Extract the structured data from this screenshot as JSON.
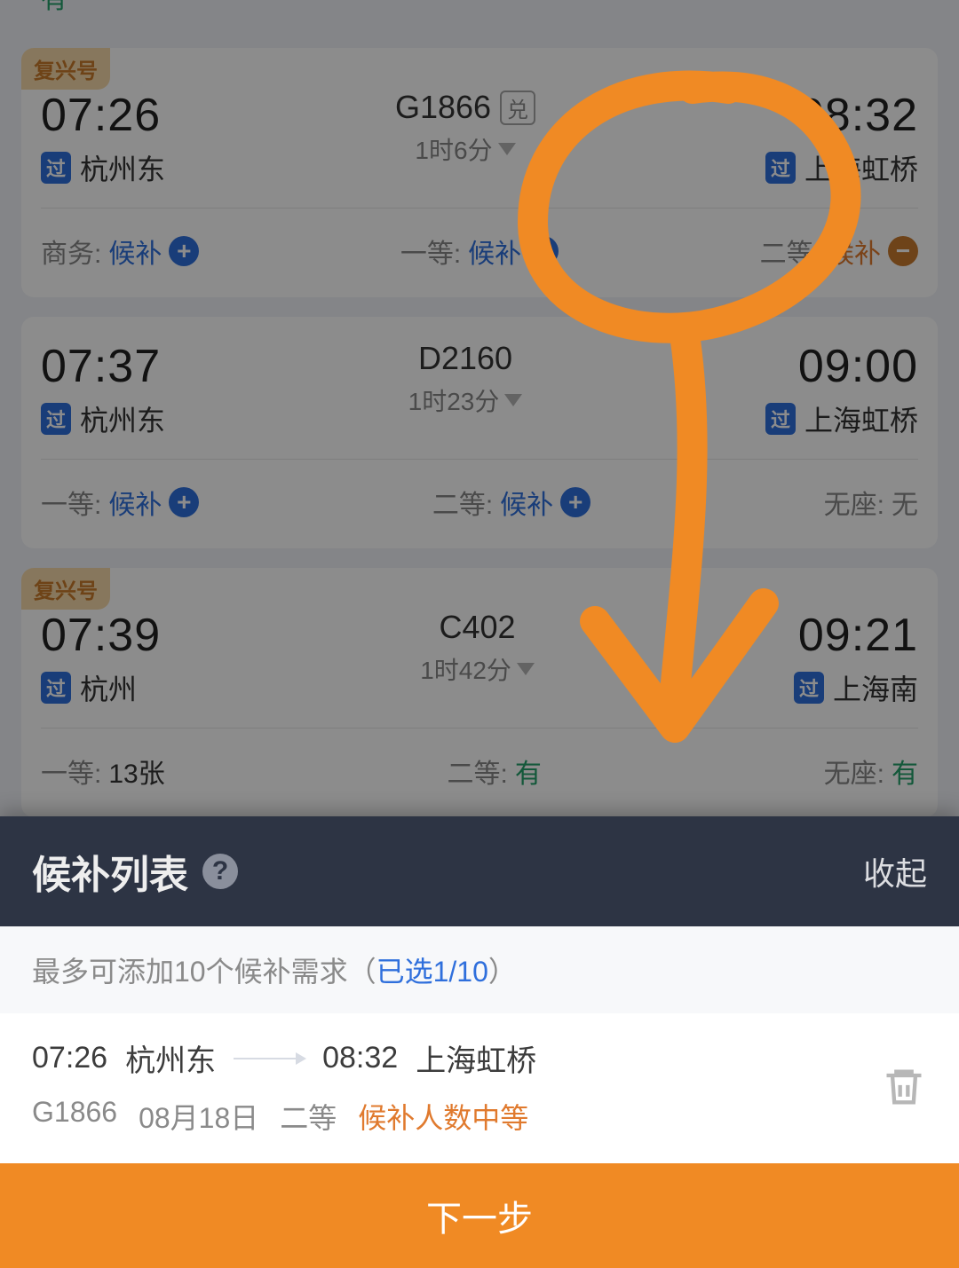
{
  "list_top_fragment": "有",
  "trains": [
    {
      "fuxing_badge": "复兴号",
      "depart_time": "07:26",
      "depart_station": "杭州东",
      "train_no": "G1866",
      "exchange_badge": "兑",
      "duration": "1时6分",
      "arrive_time": "08:32",
      "arrive_station": "上海虹桥",
      "seats": [
        {
          "label": "商务:",
          "value": "候补",
          "style": "blue",
          "icon": "plus"
        },
        {
          "label": "一等:",
          "value": "候补",
          "style": "blue",
          "icon": "plus"
        },
        {
          "label": "二等:",
          "value": "候补",
          "style": "orange",
          "icon": "minus"
        }
      ]
    },
    {
      "depart_time": "07:37",
      "depart_station": "杭州东",
      "train_no": "D2160",
      "duration": "1时23分",
      "arrive_time": "09:00",
      "arrive_station": "上海虹桥",
      "seats": [
        {
          "label": "一等:",
          "value": "候补",
          "style": "blue",
          "icon": "plus"
        },
        {
          "label": "二等:",
          "value": "候补",
          "style": "blue",
          "icon": "plus"
        },
        {
          "label": "无座:",
          "value": "无",
          "style": "gray"
        }
      ]
    },
    {
      "fuxing_badge": "复兴号",
      "depart_time": "07:39",
      "depart_station": "杭州",
      "train_no": "C402",
      "duration": "1时42分",
      "arrive_time": "09:21",
      "arrive_station": "上海南",
      "seats": [
        {
          "label": "一等:",
          "value": "13张",
          "style": "gray"
        },
        {
          "label": "二等:",
          "value": "有",
          "style": "green"
        },
        {
          "label": "无座:",
          "value": "有",
          "style": "green"
        }
      ]
    }
  ],
  "sheet": {
    "title": "候补列表",
    "collapse_label": "收起",
    "limit_prefix": "最多可添加10个候补需求（",
    "selected_count": "已选1/10",
    "limit_suffix": "）",
    "item": {
      "depart_time": "07:26",
      "depart_station": "杭州东",
      "arrive_time": "08:32",
      "arrive_station": "上海虹桥",
      "train_no": "G1866",
      "date": "08月18日",
      "seat_class": "二等",
      "status": "候补人数中等"
    },
    "next_button": "下一步"
  }
}
